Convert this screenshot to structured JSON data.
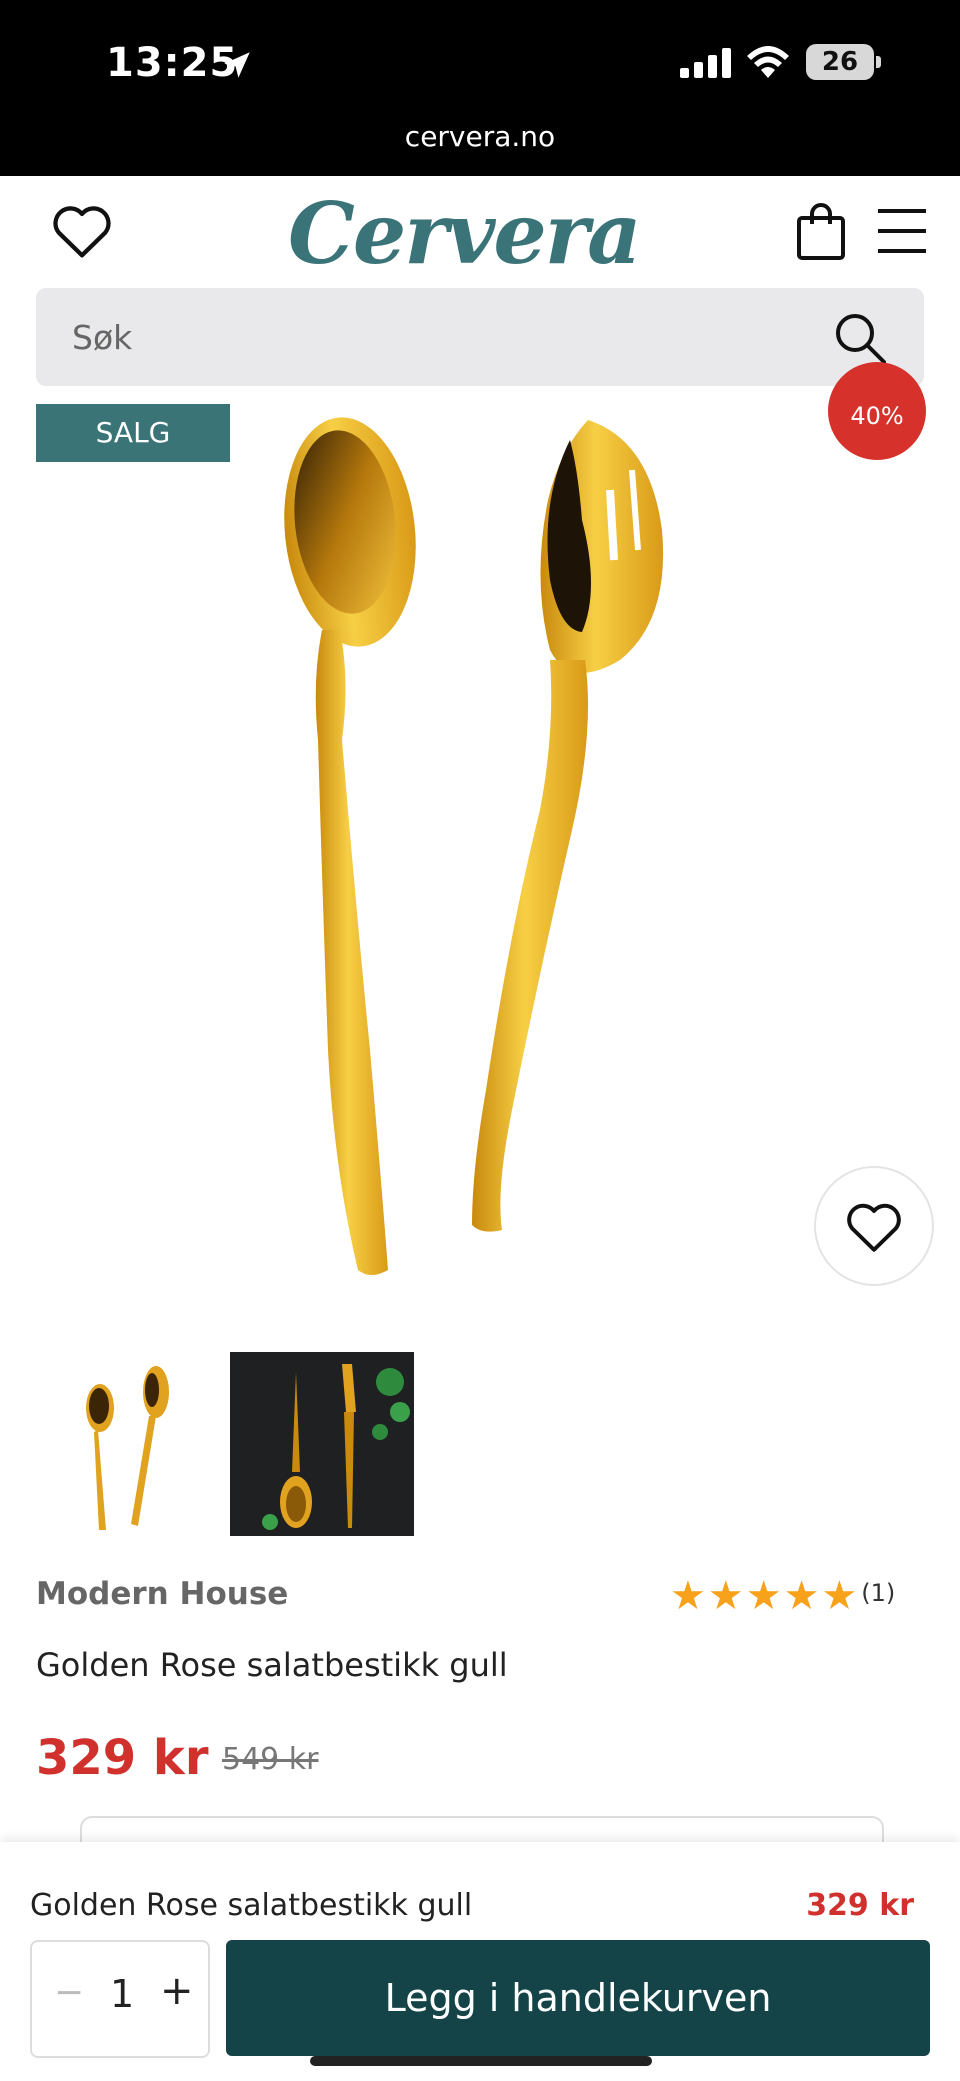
{
  "status_bar": {
    "time": "13:25",
    "battery": "26",
    "url": "cervera.no"
  },
  "header": {
    "logo": "Cervera"
  },
  "search": {
    "placeholder": "Søk"
  },
  "product": {
    "sale_badge": "SALG",
    "discount_badge": "40%",
    "brand": "Modern House",
    "rating_stars": 5,
    "review_count": "(1)",
    "title": "Golden Rose salatbestikk gull",
    "price": "329 kr",
    "old_price": "549 kr"
  },
  "sticky_bar": {
    "title": "Golden Rose salatbestikk gull",
    "price": "329 kr",
    "qty_minus": "−",
    "quantity": "1",
    "qty_plus": "+",
    "add_to_cart": "Legg i handlekurven"
  },
  "colors": {
    "brand": "#3a7478",
    "sale": "#d0312d",
    "cta": "#144447",
    "star": "#f7a21a"
  },
  "icons": [
    "location-arrow-icon",
    "signal-icon",
    "wifi-icon",
    "heart-icon",
    "bag-icon",
    "menu-icon",
    "search-icon",
    "star-icon"
  ]
}
